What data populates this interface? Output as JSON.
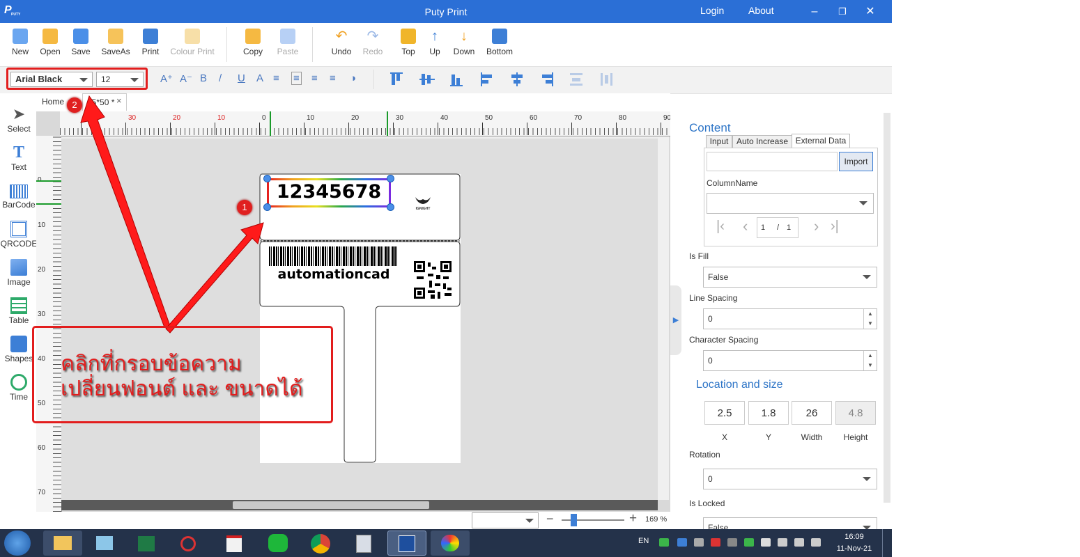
{
  "window": {
    "title": "Puty Print",
    "logo_text": "P",
    "logo_sub": "PUTY",
    "links": [
      "Login",
      "About"
    ]
  },
  "toolbar": {
    "file": [
      {
        "label": "New",
        "icon": "new-file-icon",
        "enabled": true
      },
      {
        "label": "Open",
        "icon": "folder-icon",
        "enabled": true
      },
      {
        "label": "Save",
        "icon": "save-icon",
        "enabled": true
      },
      {
        "label": "SaveAs",
        "icon": "save-as-icon",
        "enabled": true
      },
      {
        "label": "Print",
        "icon": "printer-icon",
        "enabled": true
      },
      {
        "label": "Colour Print",
        "icon": "colour-printer-icon",
        "enabled": false
      }
    ],
    "edit": [
      {
        "label": "Copy",
        "icon": "copy-icon",
        "enabled": true
      },
      {
        "label": "Paste",
        "icon": "paste-icon",
        "enabled": false
      }
    ],
    "history": [
      {
        "label": "Undo",
        "icon": "undo-icon",
        "enabled": true
      },
      {
        "label": "Redo",
        "icon": "redo-icon",
        "enabled": false
      }
    ],
    "order": [
      {
        "label": "Top",
        "icon": "layer-top-icon"
      },
      {
        "label": "Up",
        "icon": "arrow-up-icon"
      },
      {
        "label": "Down",
        "icon": "arrow-down-icon"
      },
      {
        "label": "Bottom",
        "icon": "layer-bottom-icon"
      }
    ]
  },
  "format_bar": {
    "font_family": "Arial Black",
    "font_size": "12"
  },
  "left_tools": [
    {
      "label": "Select",
      "icon": "cursor-icon"
    },
    {
      "label": "Text",
      "icon": "text-icon"
    },
    {
      "label": "BarCode",
      "icon": "barcode-icon"
    },
    {
      "label": "QRCODE",
      "icon": "qrcode-icon"
    },
    {
      "label": "Image",
      "icon": "image-icon"
    },
    {
      "label": "Table",
      "icon": "table-icon"
    },
    {
      "label": "Shapes",
      "icon": "shapes-icon"
    },
    {
      "label": "Time",
      "icon": "clock-icon"
    }
  ],
  "tabs": {
    "home": "Home",
    "doc": "45*50 *",
    "close": "×"
  },
  "ruler": {
    "h_red": [
      "40",
      "30",
      "20",
      "10"
    ],
    "h_black": [
      "0",
      "10",
      "20",
      "30",
      "40",
      "50",
      "60",
      "70",
      "80",
      "90"
    ],
    "v": [
      "0",
      "10",
      "20",
      "30",
      "40",
      "50",
      "60",
      "70"
    ]
  },
  "label": {
    "number_text": "12345678",
    "logo_text": "IGNIGHT",
    "barcode_text": "automationcad"
  },
  "annotation": {
    "badge1": "1",
    "badge2": "2",
    "note_line1": "คลิกที่กรอบข้อความ",
    "note_line2": "เปลี่ยนฟอนต์ และ ขนาดได้"
  },
  "zoom": {
    "value": "169 %"
  },
  "panel": {
    "content_title": "Content",
    "tabs": [
      "Input",
      "Auto Increase",
      "External Data"
    ],
    "import_label": "Import",
    "column_name_label": "ColumnName",
    "page_current": "1",
    "page_sep": "/",
    "page_total": "1",
    "is_fill_label": "Is Fill",
    "is_fill_value": "False",
    "line_spacing_label": "Line Spacing",
    "line_spacing_value": "0",
    "char_spacing_label": "Character Spacing",
    "char_spacing_value": "0",
    "loc_title": "Location and size",
    "x_value": "2.5",
    "y_value": "1.8",
    "width_value": "26",
    "height_value": "4.8",
    "x_label": "X",
    "y_label": "Y",
    "width_label": "Width",
    "height_label": "Height",
    "rotation_label": "Rotation",
    "rotation_value": "0",
    "locked_label": "Is Locked",
    "locked_value": "False"
  },
  "taskbar": {
    "lang": "EN",
    "time": "16:09",
    "date": "11-Nov-21"
  },
  "colors": {
    "titlebar": "#2b6fd6",
    "accent_red": "#e21d1d",
    "panel_heading": "#2e75c7"
  }
}
